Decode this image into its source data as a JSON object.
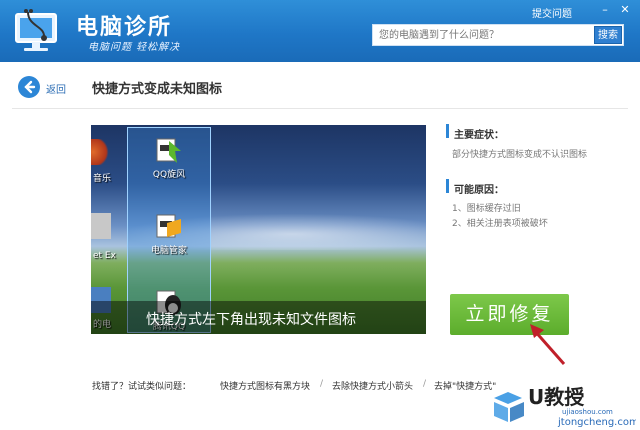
{
  "app": {
    "title": "电脑诊所",
    "slogan": "电脑问题  轻松解决",
    "top_link": "提交问题",
    "search_placeholder": "您的电脑遇到了什么问题？",
    "search_button": "搜索"
  },
  "nav": {
    "back_label": "返回",
    "page_title": "快捷方式变成未知图标"
  },
  "screenshot": {
    "caption": "快捷方式左下角出现未知文件图标",
    "desktop_icons": [
      "QQ旋风",
      "电脑管家",
      "腾讯QQ"
    ],
    "left_labels": [
      "音乐",
      "et Ex",
      "的电"
    ]
  },
  "info": {
    "symptom_head": "主要症状：",
    "symptom_text": "部分快捷方式图标变成不认识图标",
    "cause_head": "可能原因：",
    "causes": [
      "1、图标缓存过旧",
      "2、相关注册表项被破坏"
    ]
  },
  "fix_button": "立即修复",
  "bottom": {
    "lead": "找错了？试试类似问题：",
    "links": [
      "快捷方式图标有黑方块",
      "去除快捷方式小箭头",
      "去掉\"快捷方式\""
    ]
  },
  "watermark": {
    "brand": "U教授",
    "site": "ujiaoshou.com",
    "site2": "jtongcheng.com"
  },
  "colors": {
    "header": "#1f77c7",
    "accent": "#2c86d6",
    "fix_button": "#5cad2c",
    "arrow": "#c0202a"
  }
}
